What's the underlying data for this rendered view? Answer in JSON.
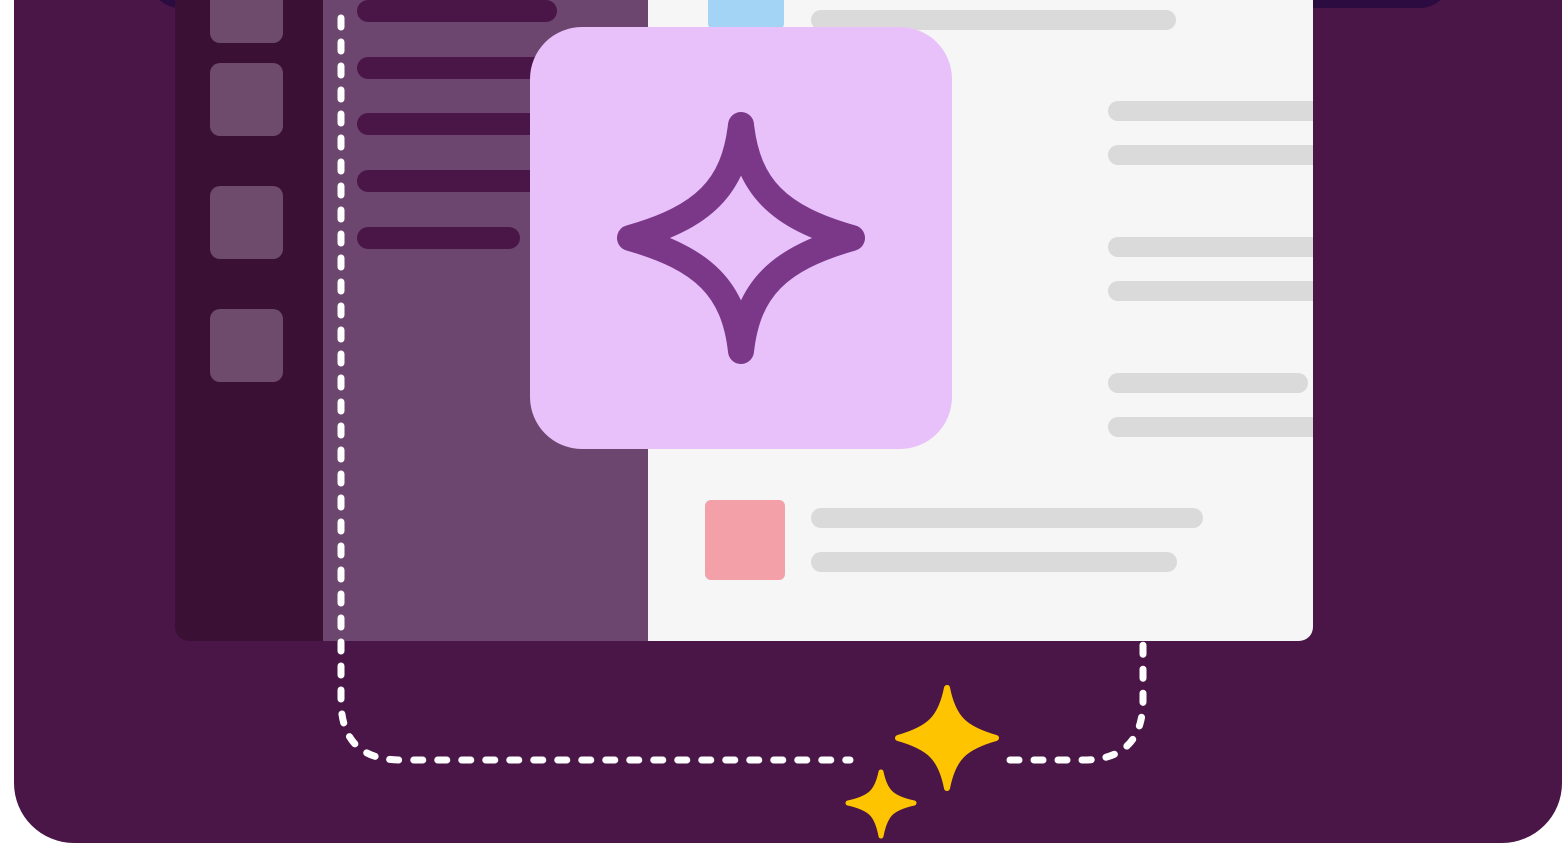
{
  "illustration": {
    "subject": "ai-assistant-in-chat-app",
    "icons": {
      "assistant": "four-point-sparkle-icon",
      "accent_large": "sparkle-icon",
      "accent_small": "sparkle-icon"
    },
    "colors": {
      "background": "#4a1647",
      "top_bar": "#2b0b40",
      "sidebar_rail": "#3a1035",
      "channel_pane": "#6d4670",
      "message_pane": "#f6f6f6",
      "text_placeholder": "#dadada",
      "ai_tile": "#e8c1fb",
      "ai_icon": "#7b3889",
      "sparkle": "#ffc400",
      "avatar_pink": "#f3a0a8",
      "avatar_blue": "#a3d4f5",
      "dashed_line": "#ffffff"
    }
  }
}
